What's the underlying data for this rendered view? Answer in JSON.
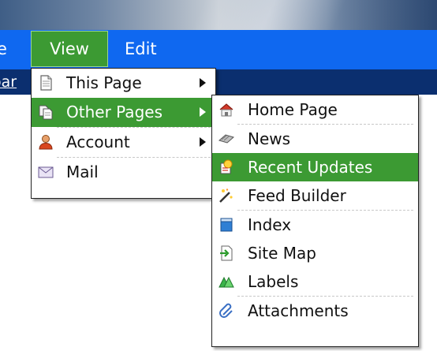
{
  "menubar": {
    "left_partial_label": "e",
    "view_label": "View",
    "edit_label": "Edit"
  },
  "strip": {
    "partial_link": "oar"
  },
  "view_menu": [
    {
      "label": "This Page",
      "icon": "page-icon",
      "submenu": true
    },
    {
      "label": "Other Pages",
      "icon": "pages-icon",
      "submenu": true,
      "active": true
    },
    {
      "label": "Account",
      "icon": "user-icon",
      "submenu": true
    },
    {
      "label": "Mail",
      "icon": "mail-icon",
      "submenu": false
    }
  ],
  "other_pages_menu": [
    {
      "label": "Home Page",
      "icon": "home-icon"
    },
    {
      "label": "News",
      "icon": "news-icon"
    },
    {
      "label": "Recent Updates",
      "icon": "recent-updates-icon",
      "active": true
    },
    {
      "label": "Feed Builder",
      "icon": "feed-builder-icon"
    },
    {
      "label": "Index",
      "icon": "index-icon"
    },
    {
      "label": "Site Map",
      "icon": "sitemap-icon"
    },
    {
      "label": "Labels",
      "icon": "labels-icon"
    },
    {
      "label": "Attachments",
      "icon": "attachments-icon"
    }
  ],
  "colors": {
    "menubar": "#0f68f0",
    "active": "#3c9a33",
    "strip": "#0b2f6f"
  }
}
